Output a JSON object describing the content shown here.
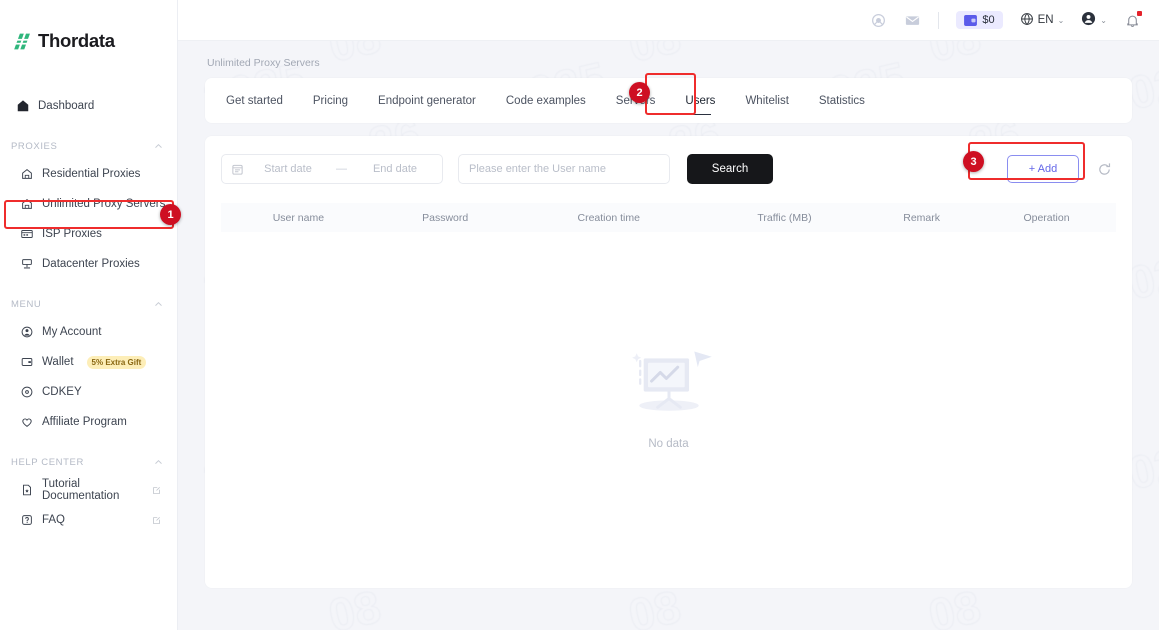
{
  "brand": {
    "name": "Thordata",
    "logo_icon": "thordata-slash-logo",
    "accent": "#2fb67c"
  },
  "topbar": {
    "icons": [
      {
        "name": "support-icon",
        "glyph": "support"
      },
      {
        "name": "mail-icon",
        "glyph": "mail"
      }
    ],
    "balance": {
      "icon": "wallet-icon",
      "value": "$0",
      "bg": "#ebeaff"
    },
    "language": {
      "icon": "globe-icon",
      "label": "EN",
      "caret": "⌄"
    },
    "account": {
      "icon": "user-avatar-icon",
      "caret": "⌄"
    },
    "notifications": {
      "icon": "bell-icon",
      "has_unread": true,
      "dot_color": "#e4222b"
    }
  },
  "sidebar": {
    "dashboard": {
      "label": "Dashboard",
      "icon": "home-icon"
    },
    "groups": [
      {
        "title": "PROXIES",
        "collapse_icon": "chevron-up-icon",
        "items": [
          {
            "label": "Residential Proxies",
            "icon": "house-proxy-icon",
            "active": false
          },
          {
            "label": "Unlimited Proxy Servers",
            "icon": "house-proxy-icon",
            "active": true
          },
          {
            "label": "ISP Proxies",
            "icon": "server-card-icon",
            "active": false
          },
          {
            "label": "Datacenter Proxies",
            "icon": "datacenter-icon",
            "active": false
          }
        ]
      },
      {
        "title": "MENU",
        "collapse_icon": "chevron-up-icon",
        "items": [
          {
            "label": "My Account",
            "icon": "user-circle-icon",
            "active": false
          },
          {
            "label": "Wallet",
            "icon": "wallet-small-icon",
            "active": false,
            "badge": "5% Extra Gift"
          },
          {
            "label": "CDKEY",
            "icon": "cdkey-icon",
            "active": false
          },
          {
            "label": "Affiliate Program",
            "icon": "affiliate-heart-icon",
            "active": false
          }
        ]
      },
      {
        "title": "HELP CENTER",
        "collapse_icon": "chevron-up-icon",
        "items": [
          {
            "label": "Tutorial Documentation",
            "icon": "document-icon",
            "external": true
          },
          {
            "label": "FAQ",
            "icon": "faq-icon",
            "external": true
          }
        ]
      }
    ]
  },
  "breadcrumb": "Unlimited Proxy Servers",
  "tabs": [
    {
      "label": "Get started",
      "active": false
    },
    {
      "label": "Pricing",
      "active": false
    },
    {
      "label": "Endpoint generator",
      "active": false
    },
    {
      "label": "Code examples",
      "active": false
    },
    {
      "label": "Servers",
      "active": false
    },
    {
      "label": "Users",
      "active": true
    },
    {
      "label": "Whitelist",
      "active": false
    },
    {
      "label": "Statistics",
      "active": false
    }
  ],
  "filters": {
    "date_icon": "calendar-icon",
    "start_date_placeholder": "Start date",
    "range_separator": "—",
    "end_date_placeholder": "End date",
    "username_value": "",
    "username_placeholder": "Please enter the User name",
    "search_label": "Search",
    "add_label": "+ Add",
    "add_icon": "plus-icon",
    "refresh_icon": "refresh-icon"
  },
  "table": {
    "columns": [
      "User name",
      "Password",
      "Creation time",
      "Traffic (MB)",
      "Remark",
      "Operation"
    ],
    "rows": [],
    "empty_text": "No data",
    "empty_icon": "no-data-chart-icon"
  },
  "annotations": [
    {
      "number": "1",
      "target": "sidebar-item-unlimited-proxy-servers"
    },
    {
      "number": "2",
      "target": "tab-users"
    },
    {
      "number": "3",
      "target": "add-button"
    }
  ]
}
